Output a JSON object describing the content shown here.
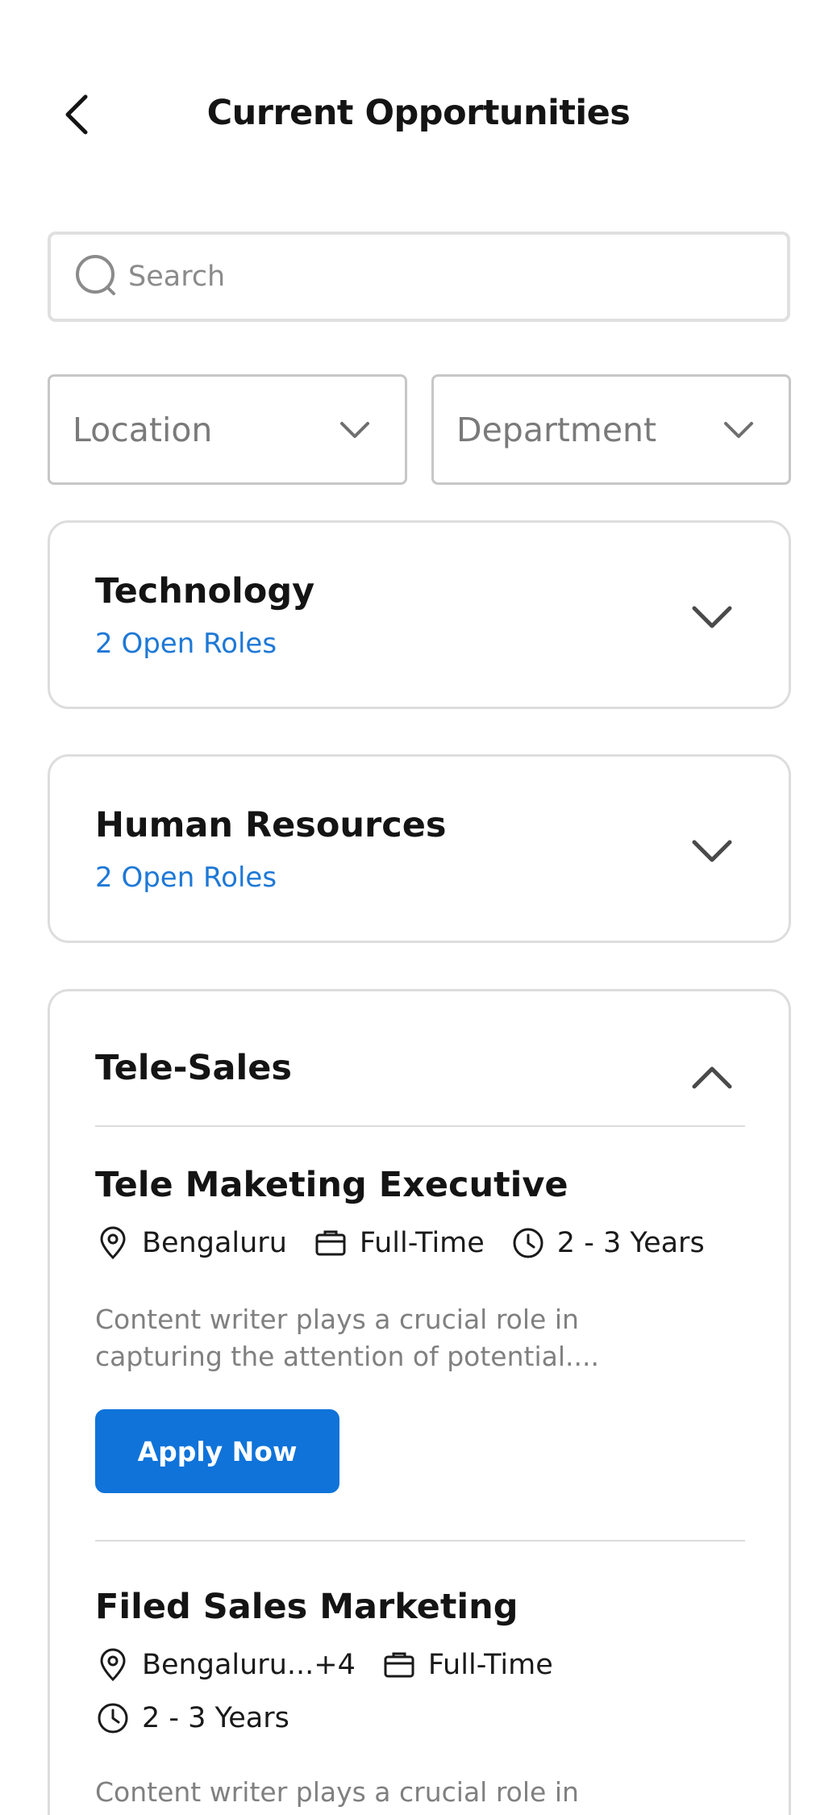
{
  "header": {
    "title": "Current Opportunities",
    "back_icon": "chevron-left-icon"
  },
  "search": {
    "placeholder": "Search",
    "value": "",
    "icon": "search-icon"
  },
  "filters": {
    "location_label": "Location",
    "department_label": "Department",
    "icon": "chevron-down-icon"
  },
  "departments": [
    {
      "name": "Technology",
      "open_roles": "2 Open Roles",
      "expanded": false
    },
    {
      "name": "Human Resources",
      "open_roles": "2 Open Roles",
      "expanded": false
    },
    {
      "name": "Tele-Sales",
      "expanded": true,
      "jobs": [
        {
          "title": "Tele Maketing Executive",
          "location": "Bengaluru",
          "type": "Full-Time",
          "experience": "2 - 3 Years",
          "description": "Content writer plays a crucial role in capturing the attention of potential....",
          "apply_label": "Apply Now"
        },
        {
          "title": "Filed Sales  Marketing",
          "location": "Bengaluru...+4",
          "type": "Full-Time",
          "experience": "2 - 3 Years",
          "description": "Content writer plays a crucial role in"
        }
      ]
    }
  ],
  "colors": {
    "accent": "#0f73d9",
    "link": "#1e78d6",
    "text": "#141414",
    "muted": "#808080",
    "border": "#dddddd"
  }
}
